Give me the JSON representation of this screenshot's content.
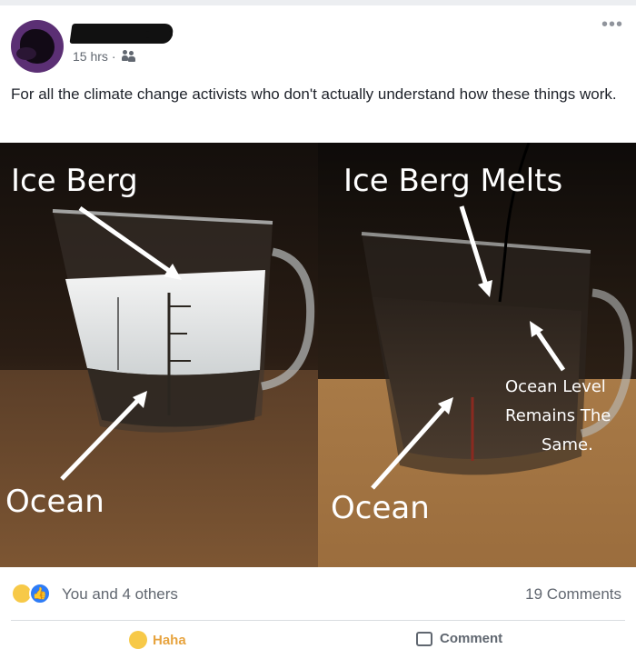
{
  "post": {
    "time": "15 hrs",
    "separator": "·",
    "audience_icon": "friends-icon",
    "text": "For all the climate change activists who don't actually understand how these things work.",
    "more_icon": "more-options-icon"
  },
  "image": {
    "left_title": "Ice Berg",
    "right_title": "Ice Berg Melts",
    "left_bottom": "Ocean",
    "right_bottom": "Ocean",
    "note_line1": "Ocean Level",
    "note_line2": "Remains The",
    "note_line3": "Same."
  },
  "footer": {
    "reaction_icons": [
      "haha-icon",
      "like-icon"
    ],
    "reactions_label": "You and 4 others",
    "comments_label": "19 Comments",
    "action_haha": "Haha",
    "action_comment": "Comment"
  },
  "colors": {
    "like_blue": "#2e7cf6",
    "haha_yellow": "#f7c948",
    "meta_gray": "#616770"
  }
}
